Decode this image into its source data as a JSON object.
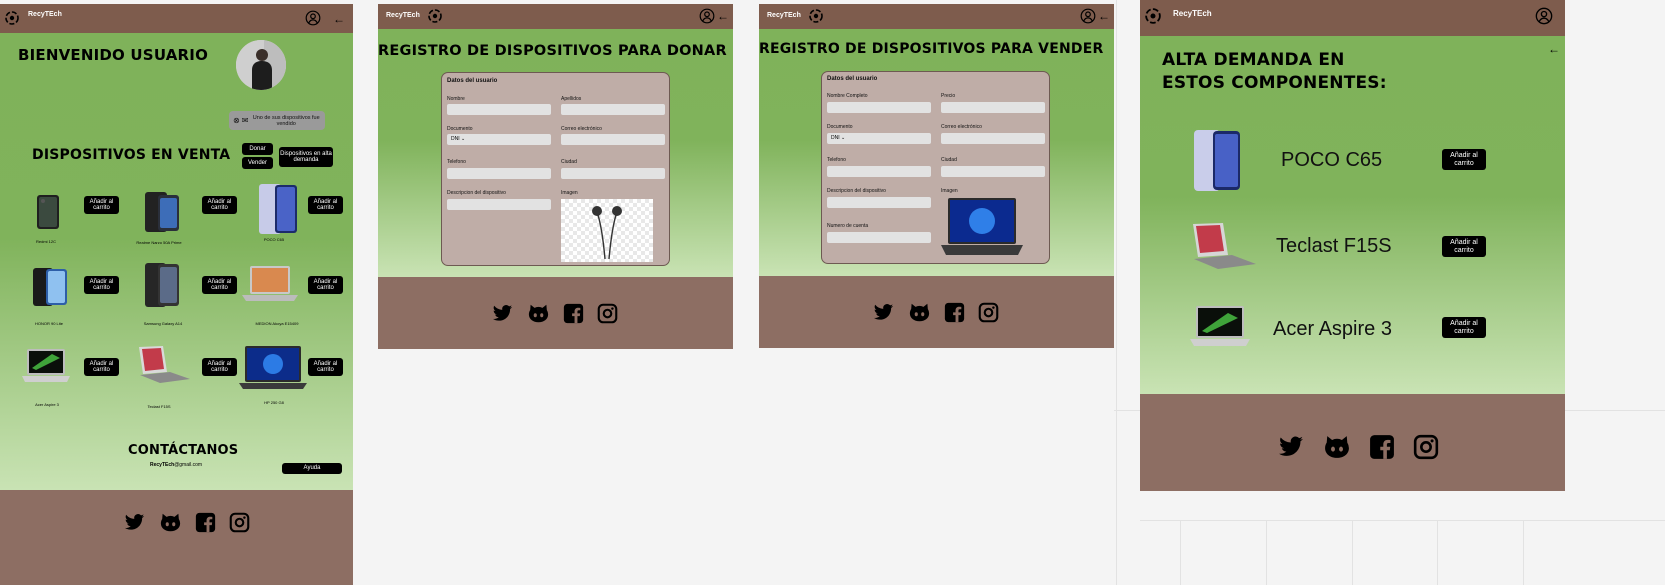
{
  "brand": "RecyTEch",
  "home": {
    "welcome": "BIENVENIDO USUARIO",
    "notice": "Uno de sus dispositivos fue vendido",
    "section_title": "DISPOSITIVOS EN VENTA",
    "donate_label": "Donar",
    "sell_label": "Vender",
    "demand_label": "Dispositivos en alta demanda",
    "cart_label": "Añadir al carrito",
    "products": [
      {
        "name": "Redmi 12C"
      },
      {
        "name": "Realme Narzo 50A Prime"
      },
      {
        "name": "POCO C65"
      },
      {
        "name": "HONOR 90 Lite"
      },
      {
        "name": "Samsung Galaxy A14"
      },
      {
        "name": "MEDION Akoya E15409"
      },
      {
        "name": "Acer Aspire 3"
      },
      {
        "name": "Teclast F15S"
      },
      {
        "name": "HP 250 G8"
      }
    ],
    "contact_title": "CONTÁCTANOS",
    "contact_email_bold": "RecyTEch",
    "contact_email_rest": "@gmail.com",
    "help_label": "Ayuda"
  },
  "donate": {
    "title": "REGISTRO DE DISPOSITIVOS PARA DONAR",
    "section": "Datos del usuario",
    "nombre": "Nombre",
    "apellidos": "Apellidos",
    "documento": "Documento",
    "doc_value": "DNI",
    "correo": "Correo electrónico",
    "telefono": "Telefono",
    "ciudad": "Ciudad",
    "descripcion": "Descripcion del dispositivo",
    "imagen": "Imagen"
  },
  "sell": {
    "title": "REGISTRO DE DISPOSITIVOS PARA VENDER",
    "section": "Datos del usuario",
    "nombre": "Nombre Completo",
    "precio": "Precio",
    "documento": "Documento",
    "doc_value": "DNI",
    "correo": "Correo electrónico",
    "telefono": "Telefono",
    "ciudad": "Ciudad",
    "descripcion": "Descripcion del dispositivo",
    "imagen": "Imagen",
    "cuenta": "Numero de cuenta"
  },
  "demand": {
    "title_line1": "ALTA DEMANDA EN",
    "title_line2": "ESTOS COMPONENTES:",
    "cart_label": "Añadir al carrito",
    "items": [
      {
        "name": "POCO C65"
      },
      {
        "name": "Teclast F15S"
      },
      {
        "name": "Acer Aspire 3"
      }
    ]
  },
  "icons": {
    "logo": "recycle-logo-icon",
    "user": "user-circle-icon",
    "back": "arrow-left-icon",
    "social": [
      "twitter-icon",
      "github-icon",
      "facebook-icon",
      "instagram-icon"
    ]
  },
  "colors": {
    "header": "#7e5c4d",
    "footer": "#8d6e63",
    "green": "#80b35b",
    "form": "#bfada7"
  }
}
